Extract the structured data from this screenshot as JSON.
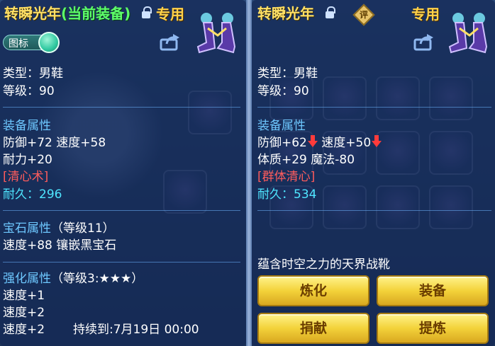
{
  "left": {
    "title_name": "转瞬光年",
    "title_current": "(当前装备)",
    "dedicated": "专用",
    "toggle_label": "图标",
    "type_line": "类型：男鞋",
    "level_line": "等级：90",
    "equip_attr_header": "装备属性",
    "attr_line1": "防御+72 速度+58",
    "attr_line2": "耐力+20",
    "special_skill": "[清心术]",
    "durability": "耐久：296",
    "gem_header": "宝石属性",
    "gem_level": "（等级11）",
    "gem_line": "速度+88 镶嵌黑宝石",
    "strengthen_header": "强化属性",
    "strengthen_level": "（等级3:★★★）",
    "strengthen_line1": "速度+1",
    "strengthen_line2": "速度+2",
    "strengthen_line3": "速度+2",
    "duration": "持续到:7月19日 00:00"
  },
  "right": {
    "title_name": "转瞬光年",
    "eval_badge": "评",
    "dedicated": "专用",
    "type_line": "类型：男鞋",
    "level_line": "等级：90",
    "equip_attr_header": "装备属性",
    "attr_line1a": "防御+62",
    "attr_line1b": "速度+50",
    "attr_line2": "体质+29 魔法-80",
    "special_skill": "[群体清心]",
    "durability": "耐久：534",
    "description": "蕴含时空之力的天界战靴",
    "buttons": {
      "refine": "炼化",
      "equip": "装备",
      "donate": "捐献",
      "extract": "提炼"
    }
  },
  "colors": {
    "title": "#ffe066",
    "current_equip": "#5dff6a",
    "section_header": "#6ec8ff",
    "special_skill": "#ff5c5c",
    "durability": "#4fe6ff",
    "button": "#f3d23a"
  }
}
